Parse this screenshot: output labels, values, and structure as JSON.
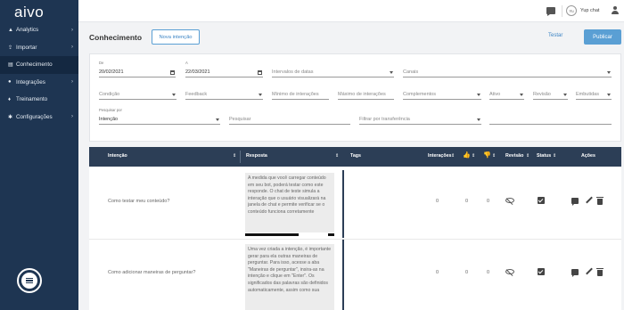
{
  "sidebar": {
    "logo": "aivo",
    "items": [
      {
        "icon": "chart-icon",
        "label": "Analytics",
        "has_arrow": true
      },
      {
        "icon": "upload-icon",
        "label": "Importar",
        "has_arrow": true
      },
      {
        "icon": "book-icon",
        "label": "Conhecimento",
        "has_arrow": false,
        "active": true
      },
      {
        "icon": "chat-icon",
        "label": "Integrações",
        "has_arrow": true
      },
      {
        "icon": "bulb-icon",
        "label": "Treinamento",
        "has_arrow": false
      },
      {
        "icon": "gear-icon",
        "label": "Configurações",
        "has_arrow": true
      }
    ]
  },
  "topbar": {
    "avatar_initials": "Yu",
    "user_name": "Yup chat"
  },
  "page": {
    "title": "Conhecimento",
    "new_intent_button": "Nova intenção",
    "test_button": "Testar",
    "publish_button": "Publicar"
  },
  "filters": {
    "date_from_label": "De",
    "date_from": "20/02/2021",
    "date_to_label": "A",
    "date_to": "22/03/2021",
    "date_ranges": "Intervalos de datas",
    "channels": "Canais",
    "condition": "Condição",
    "feedback": "Feedback",
    "min_interactions": "Mínimo de interações",
    "max_interactions": "Máximo de interações",
    "complements": "Complementos",
    "active": "Ativo",
    "review": "Revisão",
    "embedded": "Embutidas",
    "search_by_label": "Pesquisar por",
    "search_by": "Intenção",
    "search_placeholder": "Pesquisar",
    "transfer_filter": "Filtrar por transferência"
  },
  "table": {
    "headers": {
      "intent": "Intenção",
      "response": "Resposta",
      "tags": "Tags",
      "interactions": "Interações",
      "review": "Revisão",
      "status": "Status",
      "actions": "Ações"
    },
    "rows": [
      {
        "intent": "Como testar meu conteúdo?",
        "response": "A medida que você carregar conteúdo em seu bot, poderá testar como este responde. O chat de teste simula a interação que o usuário visualizará na janela de chat e permite verificar se o conteúdo funciona corretamente",
        "interactions": "0",
        "likes": "0",
        "dislikes": "0"
      },
      {
        "intent": "Como adicionar maneiras de perguntar?",
        "response": "Uma vez criada a intenção, é importante gerar para ela outras maneiras de perguntar. Para isso, acesse a aba \"Maneiras de perguntar\", insira-as na intenção e clique em \"Enter\". Os significados das palavras são definidos automaticamente, assim como sua",
        "interactions": "0",
        "likes": "0",
        "dislikes": "0"
      }
    ]
  }
}
